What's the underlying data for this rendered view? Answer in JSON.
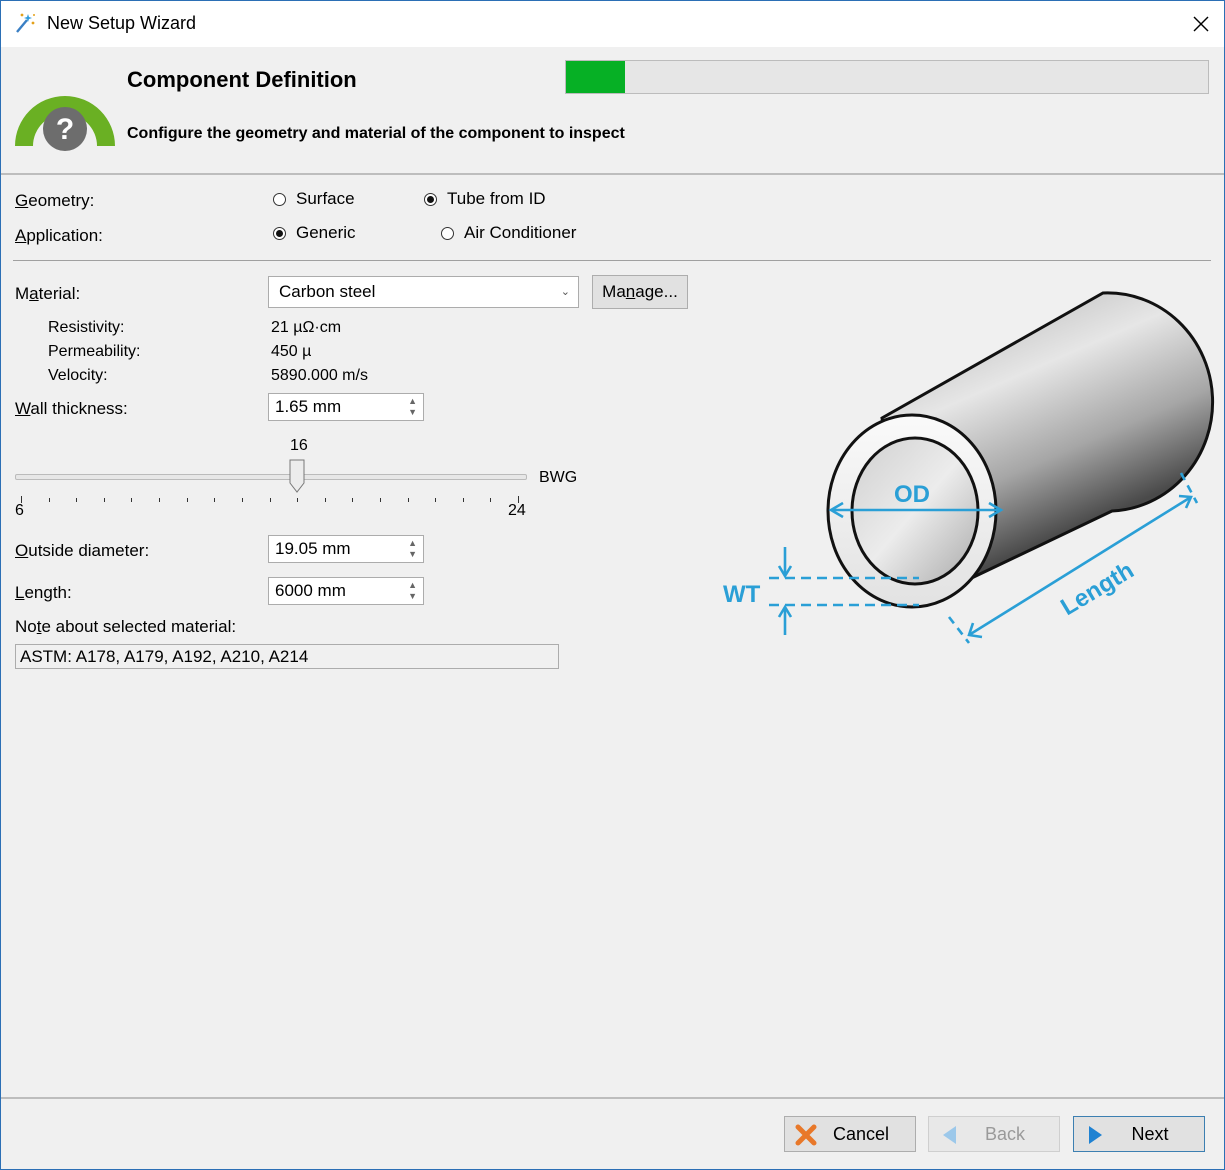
{
  "window": {
    "title": "New Setup Wizard"
  },
  "header": {
    "title": "Component Definition",
    "subtitle": "Configure the geometry and material of the component to inspect",
    "progress_fraction": 0.092
  },
  "geometry": {
    "label": "Geometry:",
    "options": [
      "Surface",
      "Tube from ID"
    ],
    "selected": "Tube from ID"
  },
  "application": {
    "label": "Application:",
    "options": [
      "Generic",
      "Air Conditioner"
    ],
    "selected": "Generic"
  },
  "material": {
    "label": "Material:",
    "value": "Carbon steel",
    "manage_button": "Manage...",
    "properties": [
      {
        "name": "Resistivity:",
        "value": "21 µΩ·cm"
      },
      {
        "name": "Permeability:",
        "value": "450 µ"
      },
      {
        "name": "Velocity:",
        "value": "5890.000 m/s"
      }
    ]
  },
  "wall_thickness": {
    "label": "Wall thickness:",
    "value": "1.65 mm",
    "slider": {
      "value": "16",
      "min": "6",
      "max": "24",
      "unit": "BWG",
      "current": 16,
      "range": [
        6,
        24
      ]
    }
  },
  "outside_diameter": {
    "label": "Outside diameter:",
    "value": "19.05 mm"
  },
  "length": {
    "label": "Length:",
    "value": "6000 mm"
  },
  "note": {
    "label": "Note about selected material:",
    "value": "ASTM: A178, A179, A192, A210, A214"
  },
  "diagram": {
    "od_label": "OD",
    "wt_label": "WT",
    "length_label": "Length",
    "accent": "#2a9fd6"
  },
  "footer": {
    "cancel": "Cancel",
    "back": "Back",
    "next": "Next"
  },
  "colors": {
    "progress": "#06b025",
    "logo_green": "#6ab023",
    "logo_gray": "#6d6d6d"
  }
}
